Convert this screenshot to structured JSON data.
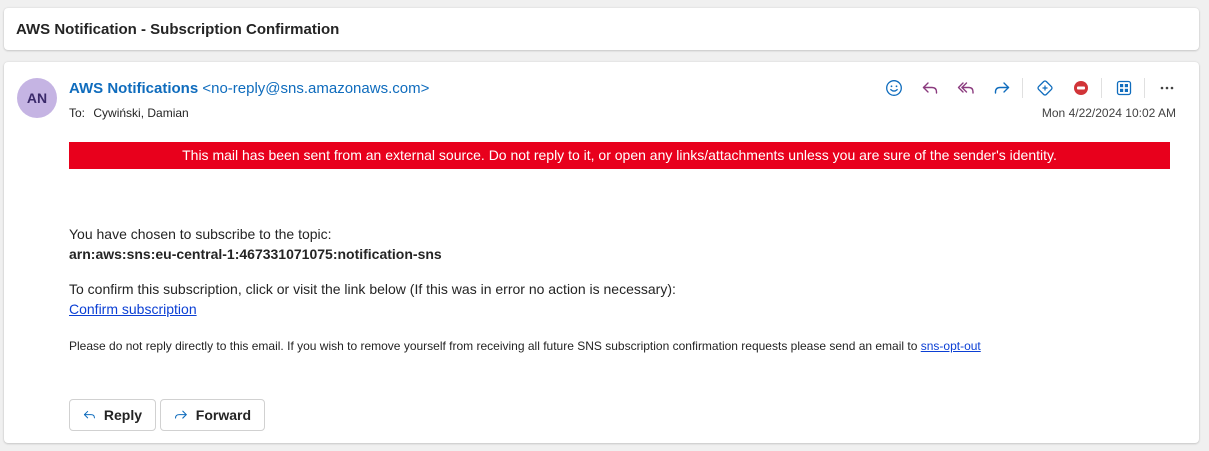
{
  "subject": "AWS Notification - Subscription Confirmation",
  "sender": {
    "initials": "AN",
    "name": "AWS Notifications",
    "email": "<no-reply@sns.amazonaws.com>",
    "avatar_color": "#c5b4e3"
  },
  "recipient": {
    "label": "To:",
    "name": "Cywiński, Damian"
  },
  "date": "Mon 4/22/2024 10:02 AM",
  "toolbar": {
    "icons": [
      "emoji-icon",
      "reply-icon",
      "reply-all-icon",
      "forward-icon",
      "immersive-reader-icon",
      "report-icon",
      "apps-icon",
      "more-icon"
    ]
  },
  "external_warning": {
    "text": "This mail has been sent from an external source. Do not reply to it, or open any links/attachments unless you are sure of the sender's identity.",
    "color": "#e8001c"
  },
  "body": {
    "topic_intro": "You have chosen to subscribe to the topic:",
    "arn": "arn:aws:sns:eu-central-1:467331071075:notification-sns",
    "confirm_instructions": "To confirm this subscription, click or visit the link below (If this was in error no action is necessary):",
    "confirm_link": "Confirm subscription",
    "opt_out_note": "Please do not reply directly to this email. If you wish to remove yourself from receiving all future SNS subscription confirmation requests please send an email to ",
    "opt_out_link": "sns-opt-out"
  },
  "actions": {
    "reply_label": "Reply",
    "forward_label": "Forward"
  }
}
